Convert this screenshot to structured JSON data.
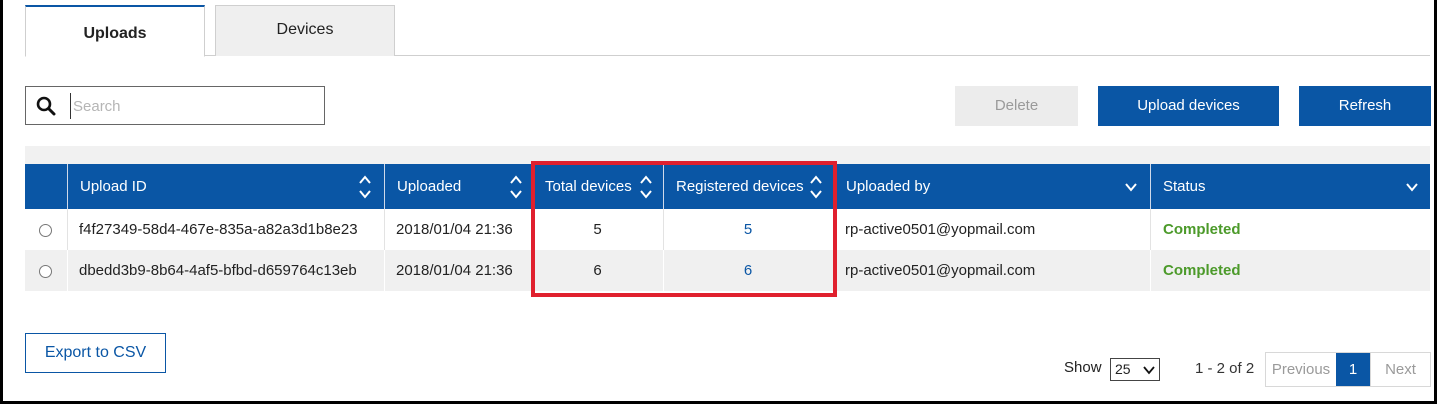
{
  "tabs": [
    {
      "label": "Uploads",
      "active": true
    },
    {
      "label": "Devices",
      "active": false
    }
  ],
  "search": {
    "placeholder": "Search",
    "value": "",
    "icon": "search-icon"
  },
  "toolbar": {
    "delete_label": "Delete",
    "upload_label": "Upload devices",
    "refresh_label": "Refresh"
  },
  "table": {
    "columns": [
      {
        "label": "Upload ID",
        "control": "sort"
      },
      {
        "label": "Uploaded",
        "control": "sort"
      },
      {
        "label": "Total devices",
        "control": "sort"
      },
      {
        "label": "Registered devices",
        "control": "sort"
      },
      {
        "label": "Uploaded by",
        "control": "filter"
      },
      {
        "label": "Status",
        "control": "filter"
      }
    ],
    "rows": [
      {
        "upload_id": "f4f27349-58d4-467e-835a-a82a3d1b8e23",
        "uploaded": "2018/01/04 21:36",
        "total": "5",
        "registered": "5",
        "uploaded_by": "rp-active0501@yopmail.com",
        "status": "Completed"
      },
      {
        "upload_id": "dbedd3b9-8b64-4af5-bfbd-d659764c13eb",
        "uploaded": "2018/01/04 21:36",
        "total": "6",
        "registered": "6",
        "uploaded_by": "rp-active0501@yopmail.com",
        "status": "Completed"
      }
    ]
  },
  "footer": {
    "export_label": "Export to CSV",
    "show_label": "Show",
    "page_size": "25",
    "range_text": "1 - 2 of 2",
    "prev_label": "Previous",
    "current_page": "1",
    "next_label": "Next"
  },
  "colors": {
    "primary": "#0a56a5",
    "success": "#4c9a2a",
    "highlight": "#e0202e"
  }
}
